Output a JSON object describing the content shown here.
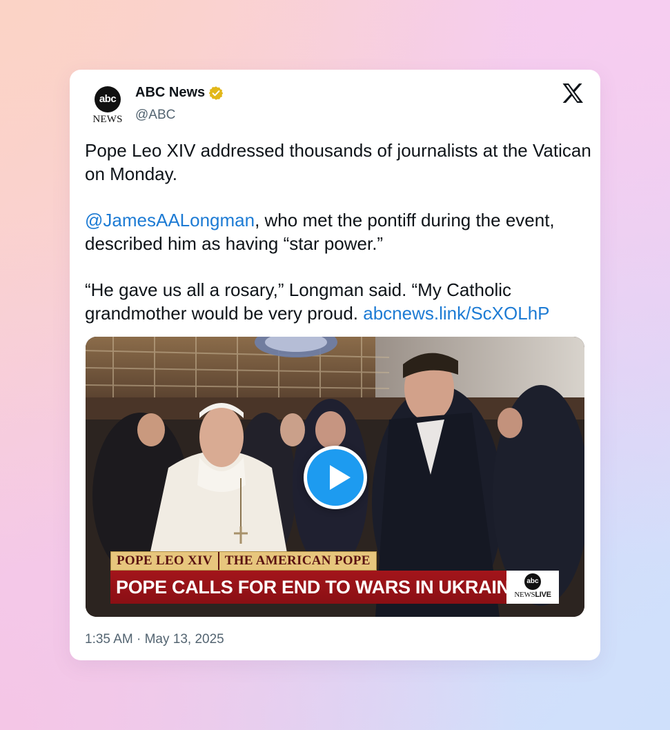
{
  "account": {
    "display_name": "ABC News",
    "handle": "@ABC",
    "avatar_circle_text": "abc",
    "avatar_wordmark": "NEWS",
    "verified_color": "#e2b719"
  },
  "platform_icon": "x-logo-icon",
  "tweet": {
    "line1": "Pope Leo XIV addressed thousands of journalists at the Vatican on Monday.",
    "mention": "@JamesAALongman",
    "line2_rest": ", who met the pontiff during the event, described him as having “star power.”",
    "line3": "“He gave us all a rosary,” Longman said. “My Catholic grandmother would be very proud.",
    "link": "abcnews.link/ScXOLhP",
    "link_color": "#1d7bd4"
  },
  "video": {
    "play_icon": "play-icon",
    "play_color": "#1d9bf0",
    "chyron_tag_1": "POPE LEO XIV",
    "chyron_tag_2": "THE AMERICAN POPE",
    "headline": "POPE CALLS FOR END TO WARS IN UKRAINE, GAZA",
    "bug_circle_text": "abc",
    "bug_news": "NEWS",
    "bug_live": "LIVE",
    "headline_color": "#a3151b"
  },
  "timestamp": "1:35 AM · May 13, 2025"
}
